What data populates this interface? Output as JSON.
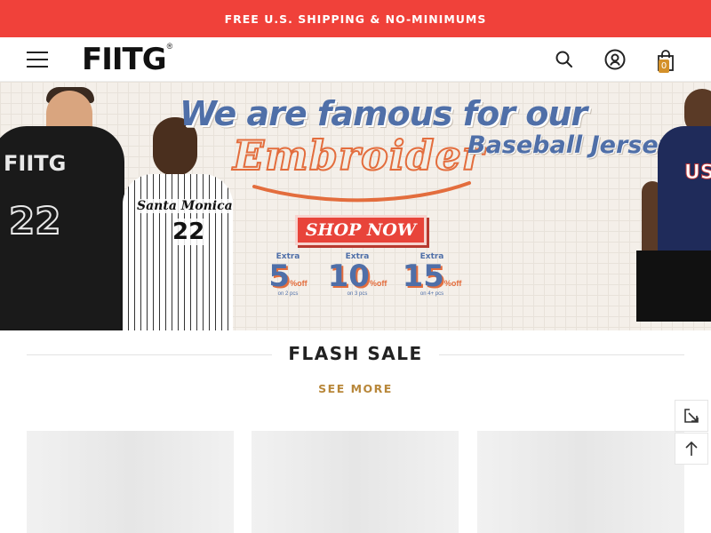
{
  "announcement": {
    "text": "FREE U.S. SHIPPING & NO-MINIMUMS"
  },
  "header": {
    "logo_text": "FIITG",
    "logo_mark": "®",
    "cart_count": "0",
    "icons": {
      "menu": "hamburger-menu-icon",
      "search": "search-icon",
      "account": "account-icon",
      "cart": "shopping-bag-icon"
    }
  },
  "hero": {
    "line1": "We are famous for our",
    "script": "Embroider",
    "line2": "Baseball Jerseys",
    "cta": "SHOP NOW",
    "discounts": [
      {
        "extra": "Extra",
        "value": "5",
        "suffix": "%off",
        "min": "on 2 pcs"
      },
      {
        "extra": "Extra",
        "value": "10",
        "suffix": "%off",
        "min": "on 3 pcs"
      },
      {
        "extra": "Extra",
        "value": "15",
        "suffix": "%off",
        "min": "on 4+ pcs"
      }
    ],
    "jersey_black": {
      "label": "FIITG",
      "number": "22"
    },
    "jersey_white": {
      "label": "Santa Monica",
      "number": "22"
    },
    "jersey_navy": {
      "label": "USA"
    }
  },
  "flash_sale": {
    "title": "FLASH SALE",
    "see_more": "SEE MORE"
  },
  "colors": {
    "announcement_bg": "#f0413a",
    "accent_gold": "#b8873a",
    "hero_blue": "#4f6fa8",
    "hero_orange": "#e36d3d"
  },
  "side_tools": {
    "icons": [
      "expand-icon",
      "back-to-top-icon"
    ]
  }
}
